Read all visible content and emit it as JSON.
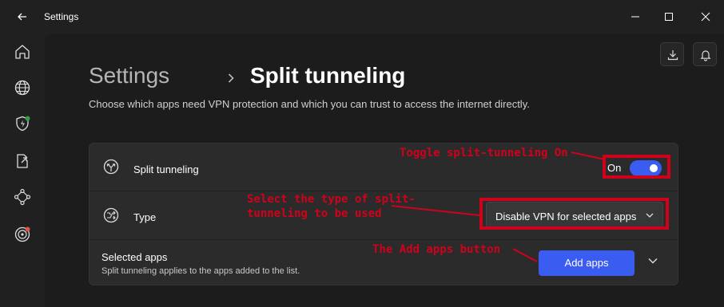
{
  "window": {
    "title": "Settings"
  },
  "header": {
    "breadcrumb_root": "Settings",
    "breadcrumb_separator": "›",
    "page_title": "Split tunneling",
    "description": "Choose which apps need VPN protection and which you can trust to access the internet directly."
  },
  "settings": {
    "split_tunneling": {
      "label": "Split tunneling",
      "toggle_text": "On",
      "enabled": true
    },
    "type": {
      "label": "Type",
      "selected": "Disable VPN for selected apps"
    },
    "selected_apps": {
      "title": "Selected apps",
      "subtitle": "Split tunneling applies to the apps added to the list.",
      "add_button": "Add apps"
    }
  },
  "annotations": {
    "toggle": "Toggle split-tunneling On",
    "type_line1": "Select the type of split-",
    "type_line2": "tunneling to be used",
    "add": "The Add apps button"
  },
  "colors": {
    "accent": "#3b5cf0",
    "annotation": "#d0021b",
    "background": "#202020",
    "card": "#2b2b2b"
  },
  "icons": {
    "sidebar": [
      "home-icon",
      "globe-icon",
      "shield-bolt-icon",
      "export-icon",
      "network-icon",
      "target-icon"
    ],
    "header": [
      "download-icon",
      "bell-icon"
    ]
  }
}
